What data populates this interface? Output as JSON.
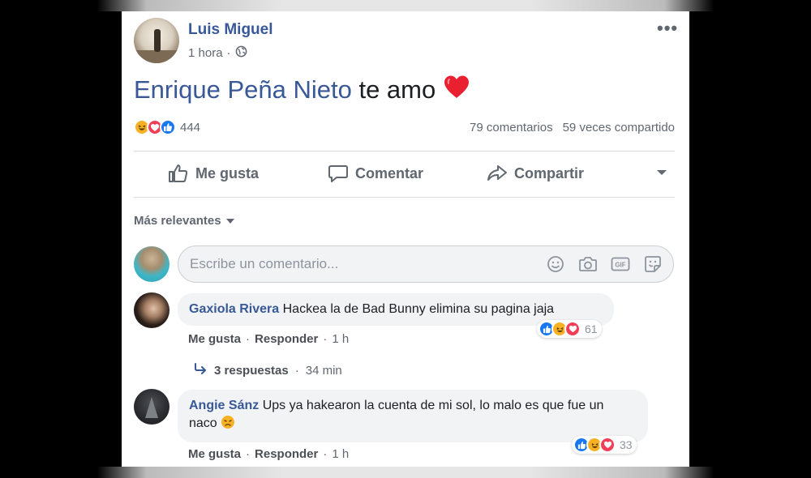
{
  "post": {
    "author": "Luis Miguel",
    "time": "1 hora",
    "privacy_icon": "globe-icon",
    "text_mention": "Enrique Peña Nieto",
    "text_rest": "te amo",
    "emoji": "heart",
    "reaction_icons": [
      "haha",
      "love",
      "like"
    ],
    "reaction_count": "444",
    "comments_count": "79 comentarios",
    "shares_count": "59 veces compartido"
  },
  "actions": {
    "like": "Me gusta",
    "comment": "Comentar",
    "share": "Compartir"
  },
  "sort": {
    "label": "Más relevantes"
  },
  "composer": {
    "placeholder": "Escribe un comentario...",
    "icons": [
      "emoji-icon",
      "camera-icon",
      "gif-icon",
      "sticker-icon"
    ]
  },
  "comments": [
    {
      "name": "Gaxiola Rivera",
      "text": "Hackea la de Bad Bunny elimina su pagina jaja",
      "reaction_icons": [
        "like",
        "haha",
        "love"
      ],
      "reaction_count": "61",
      "like_label": "Me gusta",
      "reply_label": "Responder",
      "time": "1 h",
      "replies_label": "3 respuestas",
      "replies_time": "34 min"
    },
    {
      "name": "Angie Sánz",
      "text": "Ups ya hakearon la cuenta de mi sol, lo malo es que fue un naco",
      "reaction_icons": [
        "like",
        "haha",
        "love"
      ],
      "reaction_count": "33",
      "like_label": "Me gusta",
      "reply_label": "Responder",
      "time": "1 h"
    }
  ],
  "colors": {
    "link_blue": "#385898",
    "like_blue": "#1877f2",
    "love_red": "#f33e58",
    "haha_yellow": "#f7b125",
    "muted_text": "#606770"
  }
}
